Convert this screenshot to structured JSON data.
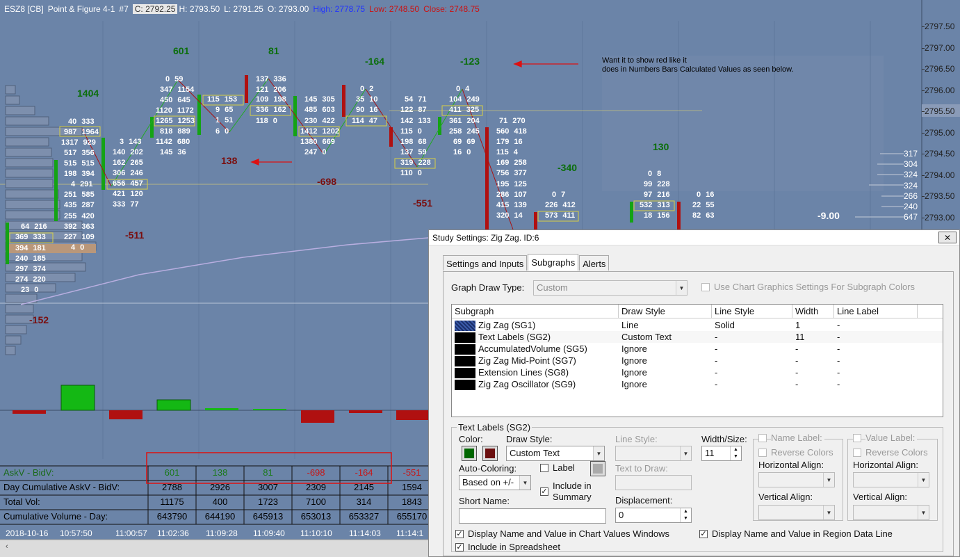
{
  "header": {
    "symbol": "ESZ8 [CB]",
    "chart_type": "Point & Figure 4-1",
    "chart_num": "#7",
    "c_val": "C: 2792.25",
    "h_val": "H: 2793.50",
    "l_val": "L: 2791.25",
    "o_val": "O: 2793.00",
    "high": "High: 2778.75",
    "low": "Low: 2748.50",
    "close": "Close: 2748.75"
  },
  "price_axis": [
    "2797.50",
    "2797.00",
    "2796.50",
    "2796.00",
    "2795.50",
    "2795.00",
    "2794.50",
    "2794.00",
    "2793.50",
    "2793.00"
  ],
  "profile_labels": [
    "317",
    "304",
    "324",
    "324",
    "266",
    "240",
    "647"
  ],
  "big_value": "-9.00",
  "annotation": [
    "Want it to show red like it",
    "does in Numbers Bars Calculated Values as seen below."
  ],
  "zigzag_labels": [
    {
      "t": "601",
      "c": "green"
    },
    {
      "t": "81",
      "c": "green"
    },
    {
      "t": "1404",
      "c": "green"
    },
    {
      "t": "-164",
      "c": "green"
    },
    {
      "t": "-123",
      "c": "green"
    },
    {
      "t": "138",
      "c": "red"
    },
    {
      "t": "-698",
      "c": "red"
    },
    {
      "t": "-551",
      "c": "red"
    },
    {
      "t": "-511",
      "c": "red"
    },
    {
      "t": "-152",
      "c": "red"
    },
    {
      "t": "-340",
      "c": "green"
    },
    {
      "t": "130",
      "c": "green"
    }
  ],
  "table": {
    "rows": [
      {
        "label": "AskV - BidV:",
        "values": [
          "601",
          "138",
          "81",
          "-698",
          "-164",
          "-551"
        ],
        "colors": [
          "green",
          "green",
          "green",
          "red",
          "red",
          "red"
        ]
      },
      {
        "label": "Day Cumulative AskV - BidV:",
        "values": [
          "2788",
          "2926",
          "3007",
          "2309",
          "2145",
          "1594"
        ]
      },
      {
        "label": "Total Vol:",
        "values": [
          "11175",
          "400",
          "1723",
          "7100",
          "314",
          "1843"
        ]
      },
      {
        "label": "Cumulative Volume - Day:",
        "values": [
          "643790",
          "644190",
          "645913",
          "653013",
          "653327",
          "655170"
        ]
      }
    ]
  },
  "time_axis": [
    "2018-10-16",
    "10:57:50",
    "11:00:57",
    "11:02:36",
    "11:09:28",
    "11:09:40",
    "11:10:10",
    "11:14:03",
    "11:14:1"
  ],
  "dialog": {
    "title": "Study Settings: Zig Zag. ID:6",
    "close": "✕",
    "tabs": [
      "Settings and Inputs",
      "Subgraphs",
      "Alerts"
    ],
    "graph_draw_type_label": "Graph Draw Type:",
    "graph_draw_type_value": "Custom",
    "use_chart_graphics": "Use Chart Graphics Settings For Subgraph Colors",
    "columns": [
      "Subgraph",
      "Draw Style",
      "Line Style",
      "Width",
      "Line Label"
    ],
    "subgraphs": [
      {
        "name": "Zig Zag (SG1)",
        "draw": "Line",
        "line": "Solid",
        "width": "1",
        "label": "-"
      },
      {
        "name": "Text Labels (SG2)",
        "draw": "Custom Text",
        "line": "-",
        "width": "11",
        "label": "-"
      },
      {
        "name": "AccumulatedVolume (SG5)",
        "draw": "Ignore",
        "line": "-",
        "width": "-",
        "label": "-"
      },
      {
        "name": "Zig Zag Mid-Point (SG7)",
        "draw": "Ignore",
        "line": "-",
        "width": "-",
        "label": "-"
      },
      {
        "name": "Extension Lines (SG8)",
        "draw": "Ignore",
        "line": "-",
        "width": "-",
        "label": "-"
      },
      {
        "name": "Zig Zag Oscillator (SG9)",
        "draw": "Ignore",
        "line": "-",
        "width": "-",
        "label": "-"
      }
    ],
    "section_title": "Text Labels (SG2)",
    "color_label": "Color:",
    "color1": "#006600",
    "color2": "#6b0f0f",
    "draw_style_label": "Draw Style:",
    "draw_style_value": "Custom Text",
    "line_style_label": "Line Style:",
    "width_label": "Width/Size:",
    "width_value": "11",
    "auto_coloring_label": "Auto-Coloring:",
    "auto_coloring_value": "Based on +/-",
    "label_cb": "Label",
    "text_to_draw_label": "Text to Draw:",
    "include_summary_1": "Include in",
    "include_summary_2": "Summary",
    "short_name_label": "Short Name:",
    "displacement_label": "Displacement:",
    "displacement_value": "0",
    "name_label": "Name Label:",
    "value_label": "Value Label:",
    "reverse_colors": "Reverse Colors",
    "horizontal_align": "Horizontal Align:",
    "vertical_align": "Vertical Align:",
    "display_chart_values": "Display Name and Value in Chart Values Windows",
    "display_region": "Display Name and Value in Region Data Line",
    "include_spreadsheet": "Include in Spreadsheet"
  }
}
